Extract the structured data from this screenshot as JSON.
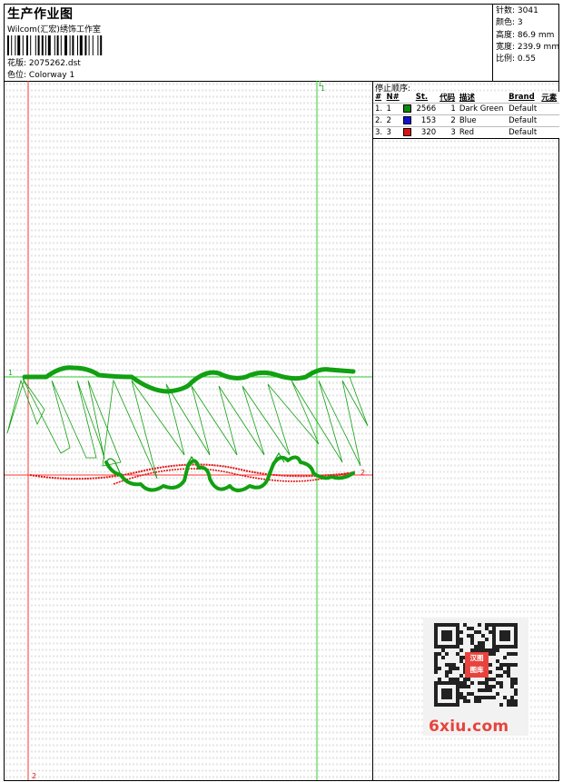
{
  "header": {
    "title": "生产作业图",
    "company": "Wilcom(汇宏)绣饰工作室",
    "design_label": "花版:",
    "design_value": "2075262.dst",
    "colorway_label": "色位:",
    "colorway_value": "Colorway 1"
  },
  "stats": [
    {
      "label": "针数:",
      "value": "3041"
    },
    {
      "label": "颜色:",
      "value": "3"
    },
    {
      "label": "高度:",
      "value": "86.9 mm"
    },
    {
      "label": "宽度:",
      "value": "239.9 mm"
    },
    {
      "label": "比例:",
      "value": "0.55"
    }
  ],
  "canvas": {
    "marker_top_left": "1",
    "marker_top_right": "1",
    "marker_mid_left": "1",
    "marker_mid_right": "2",
    "marker_bottom_left": "2",
    "colors": {
      "green": "#11a011",
      "red": "#e21212",
      "guide_red": "#ff3030",
      "guide_green": "#33cc33"
    }
  },
  "stop_sequence": {
    "heading": "停止顺序:",
    "columns": [
      "#",
      "N#",
      "St.",
      "代码",
      "描述",
      "Brand",
      "元素"
    ],
    "rows": [
      {
        "idx": "1.",
        "n": "1",
        "color": "#0e8a0e",
        "st": "2566",
        "code": "1",
        "desc": "Dark Green",
        "brand": "Default"
      },
      {
        "idx": "2.",
        "n": "2",
        "color": "#1010d8",
        "st": "153",
        "code": "2",
        "desc": "Blue",
        "brand": "Default"
      },
      {
        "idx": "3.",
        "n": "3",
        "color": "#e01010",
        "st": "320",
        "code": "3",
        "desc": "Red",
        "brand": "Default"
      }
    ]
  },
  "watermark": {
    "badge_top": "汉图",
    "badge_bottom": "图库",
    "site": "6xiu.com"
  }
}
